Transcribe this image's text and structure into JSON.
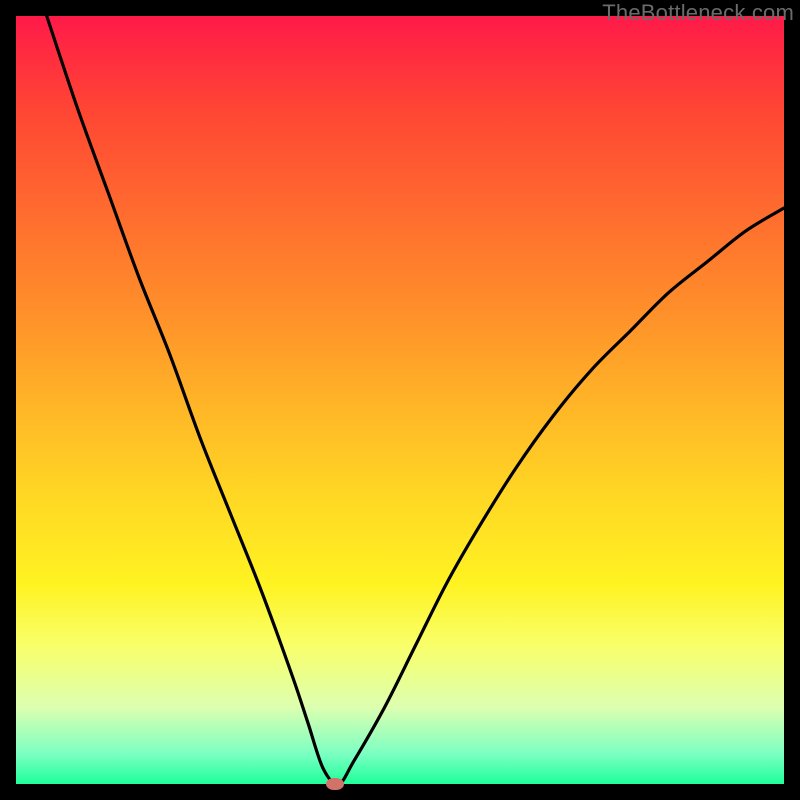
{
  "watermark": "TheBottleneck.com",
  "chart_data": {
    "type": "line",
    "title": "",
    "xlabel": "",
    "ylabel": "",
    "xlim": [
      0,
      100
    ],
    "ylim": [
      0,
      100
    ],
    "grid": false,
    "legend": false,
    "series": [
      {
        "name": "curve",
        "color": "#000000",
        "x": [
          4,
          8,
          12,
          16,
          20,
          24,
          28,
          32,
          36,
          38,
          40,
          42,
          44,
          48,
          52,
          56,
          60,
          65,
          70,
          75,
          80,
          85,
          90,
          95,
          100
        ],
        "y": [
          100,
          88,
          77,
          66,
          56,
          45,
          35,
          25,
          14,
          8,
          2,
          0,
          3,
          10,
          18,
          26,
          33,
          41,
          48,
          54,
          59,
          64,
          68,
          72,
          75
        ]
      }
    ],
    "marker": {
      "x": 41.5,
      "y": 0,
      "color": "#d1726b"
    }
  }
}
